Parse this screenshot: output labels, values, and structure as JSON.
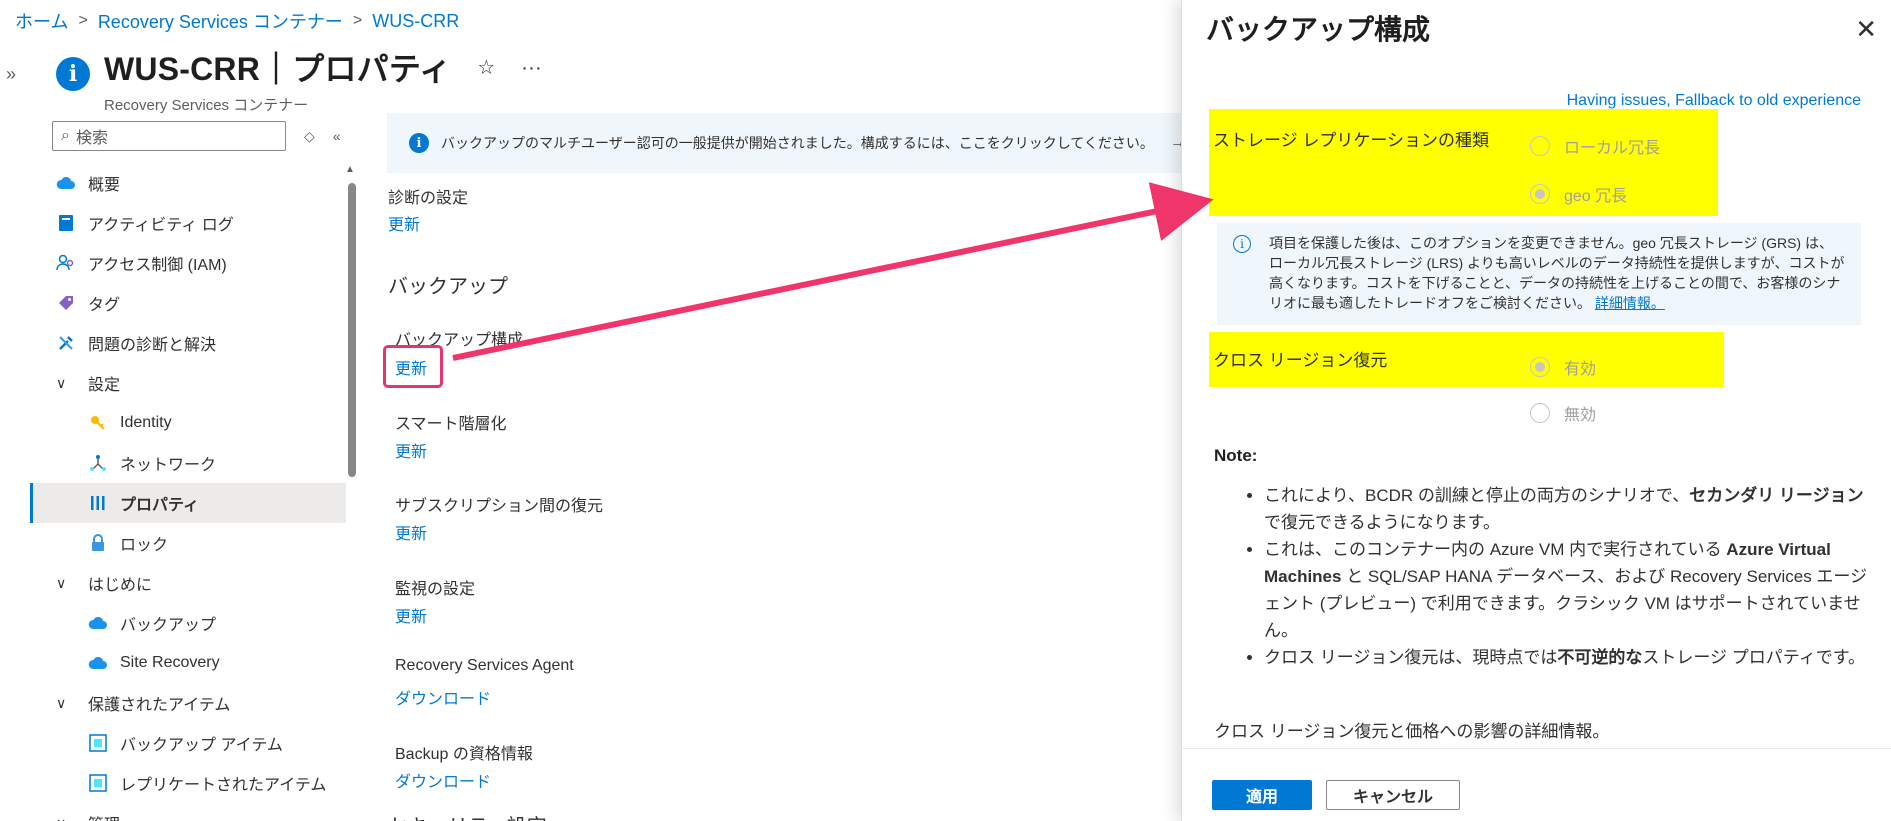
{
  "breadcrumb": {
    "home": "ホーム",
    "vaults": "Recovery Services コンテナー",
    "current": "WUS-CRR"
  },
  "header": {
    "title": "WUS-CRR｜プロパティ",
    "subtitle": "Recovery Services コンテナー",
    "favorite_glyph": "☆",
    "more_glyph": "···"
  },
  "search": {
    "placeholder": "検索"
  },
  "sidebar": {
    "items": [
      {
        "label": "概要",
        "icon": "cloud-icon"
      },
      {
        "label": "アクティビティ ログ",
        "icon": "log-icon"
      },
      {
        "label": "アクセス制御 (IAM)",
        "icon": "people-icon"
      },
      {
        "label": "タグ",
        "icon": "tag-icon"
      },
      {
        "label": "問題の診断と解決",
        "icon": "wrench-icon"
      },
      {
        "label": "設定",
        "group": true
      },
      {
        "label": "Identity",
        "icon": "key-icon"
      },
      {
        "label": "ネットワーク",
        "icon": "network-icon"
      },
      {
        "label": "プロパティ",
        "icon": "properties-icon",
        "selected": true
      },
      {
        "label": "ロック",
        "icon": "lock-icon"
      },
      {
        "label": "はじめに",
        "group": true
      },
      {
        "label": "バックアップ",
        "icon": "backup-icon"
      },
      {
        "label": "Site Recovery",
        "icon": "site-recovery-icon"
      },
      {
        "label": "保護されたアイテム",
        "group": true
      },
      {
        "label": "バックアップ アイテム",
        "icon": "backup-items-icon"
      },
      {
        "label": "レプリケートされたアイテム",
        "icon": "replicated-items-icon"
      },
      {
        "label": "管理",
        "group": true
      }
    ]
  },
  "banner": {
    "text": "バックアップのマルチユーザー認可の一般提供が開始されました。構成するには、ここをクリックしてください。",
    "arrow": "→"
  },
  "content": {
    "diag_label": "診断の設定",
    "diag_link": "更新",
    "backup_section": "バックアップ",
    "backup_config_label": "バックアップ構成",
    "backup_config_link": "更新",
    "smart_tier_label": "スマート階層化",
    "smart_tier_link": "更新",
    "cross_sub_label": "サブスクリプション間の復元",
    "cross_sub_link": "更新",
    "monitor_label": "監視の設定",
    "monitor_link": "更新",
    "agent_label": "Recovery Services Agent",
    "agent_link": "ダウンロード",
    "creds_label": "Backup の資格情報",
    "creds_link": "ダウンロード",
    "security_section": "セキュリティ設定"
  },
  "panel": {
    "title": "バックアップ構成",
    "close_glyph": "✕",
    "fallback_link": "Having issues, Fallback to old experience",
    "replication_label": "ストレージ レプリケーションの種類",
    "replication_options": [
      "ローカル冗長",
      "geo 冗長"
    ],
    "replication_selected": "geo 冗長",
    "info_text": "項目を保護した後は、このオプションを変更できません。geo 冗長ストレージ (GRS) は、ローカル冗長ストレージ (LRS) よりも高いレベルのデータ持続性を提供しますが、コストが高くなります。コストを下げることと、データの持続性を上げることの間で、お客様のシナリオに最も適したトレードオフをご検討ください。",
    "info_link": "詳細情報。",
    "crr_label": "クロス リージョン復元",
    "crr_options": [
      "有効",
      "無効"
    ],
    "crr_selected": "有効",
    "note_title": "Note:",
    "note_1a": "これにより、BCDR の訓練と停止の両方のシナリオで、",
    "note_1b": "セカンダリ リージョン",
    "note_1c": "で復元できるようになります。",
    "note_2a": "これは、このコンテナー内の Azure VM 内で実行されている ",
    "note_2b": "Azure Virtual Machines",
    "note_2c": " と SQL/SAP HANA データベース、および Recovery Services エージェント (プレビュー) で利用できます。クラシック VM はサポートされていません。",
    "note_3a": "クロス リージョン復元は、現時点では",
    "note_3b": "不可逆的な",
    "note_3c": "ストレージ プロパティです。",
    "note_after": "クロス リージョン復元と価格への影響の詳細情報。",
    "apply_button": "適用",
    "cancel_button": "キャンセル"
  },
  "colors": {
    "accent": "#0078d4",
    "highlight_yellow": "#ffff00",
    "annotation_pink": "#e6376c"
  }
}
